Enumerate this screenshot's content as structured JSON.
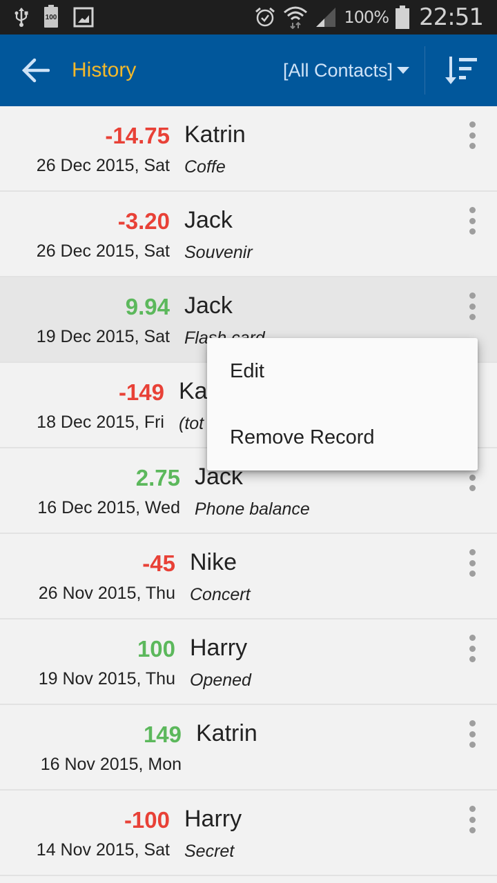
{
  "status_bar": {
    "left_icons": [
      "usb-icon",
      "battery-100-icon",
      "gallery-icon"
    ],
    "battery_badge": "100",
    "battery_percent": "100%",
    "time": "22:51"
  },
  "toolbar": {
    "title": "History",
    "filter_label": "[All Contacts]",
    "colors": {
      "background": "#01579b",
      "title": "#f4b92a",
      "filter": "#cfe3f7"
    }
  },
  "records": [
    {
      "amount": "-14.75",
      "sign": "neg",
      "date": "26 Dec 2015, Sat",
      "name": "Katrin",
      "note": "Coffe"
    },
    {
      "amount": "-3.20",
      "sign": "neg",
      "date": "26 Dec 2015, Sat",
      "name": "Jack",
      "note": "Souvenir"
    },
    {
      "amount": "9.94",
      "sign": "pos",
      "date": "19 Dec 2015, Sat",
      "name": "Jack",
      "note": "Flash card",
      "selected": true
    },
    {
      "amount": "-149",
      "sign": "neg",
      "date": "18 Dec 2015, Fri",
      "name": "Ka",
      "note": "(tot"
    },
    {
      "amount": "2.75",
      "sign": "pos",
      "date": "16 Dec 2015, Wed",
      "name": "Jack",
      "note": "Phone balance"
    },
    {
      "amount": "-45",
      "sign": "neg",
      "date": "26 Nov 2015, Thu",
      "name": "Nike",
      "note": "Concert"
    },
    {
      "amount": "100",
      "sign": "pos",
      "date": "19 Nov 2015, Thu",
      "name": "Harry",
      "note": "Opened"
    },
    {
      "amount": "149",
      "sign": "pos",
      "date": "16 Nov 2015, Mon",
      "name": "Katrin",
      "note": ""
    },
    {
      "amount": "-100",
      "sign": "neg",
      "date": "14 Nov 2015, Sat",
      "name": "Harry",
      "note": "Secret"
    }
  ],
  "popup_menu": {
    "items": [
      "Edit",
      "Remove Record"
    ]
  },
  "colors": {
    "positive": "#5cb85c",
    "negative": "#e84137",
    "list_bg": "#f2f2f2",
    "selected_bg": "#e6e6e6"
  }
}
